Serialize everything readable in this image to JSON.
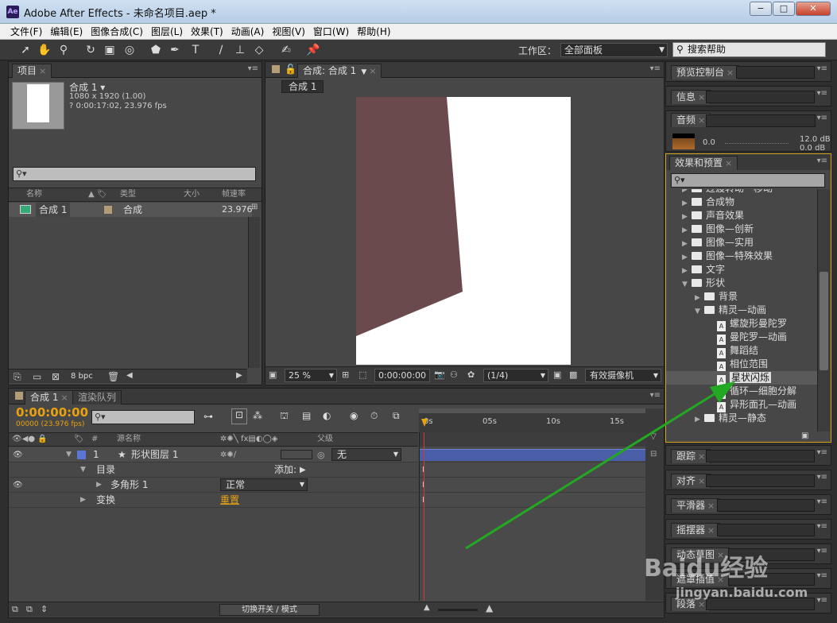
{
  "window": {
    "title": "Adobe After Effects - 未命名项目.aep *",
    "logo": "Ae",
    "minimize": "−",
    "maximize": "□",
    "close": "✕"
  },
  "menu": [
    "文件(F)",
    "编辑(E)",
    "图像合成(C)",
    "图层(L)",
    "效果(T)",
    "动画(A)",
    "视图(V)",
    "窗口(W)",
    "帮助(H)"
  ],
  "toolbar": {
    "workspace_label": "工作区：",
    "workspace_value": "全部面板",
    "search_help": "搜索帮助"
  },
  "project": {
    "tab": "项目",
    "comp_name": "合成 1 ▾",
    "comp_res": "1080 x 1920 (1.00)",
    "comp_dur": "? 0:00:17:02, 23.976 fps",
    "columns": [
      "名称",
      "类型",
      "大小",
      "帧速率"
    ],
    "item": {
      "name": "合成 1",
      "type": "合成",
      "fps": "23.976"
    },
    "bpc": "8 bpc"
  },
  "comp": {
    "tab": "合成: 合成 1",
    "subtab": "合成 1",
    "zoom": "25 %",
    "timecode": "0:00:00:00",
    "resolution": "(1/4)",
    "camera": "有效摄像机"
  },
  "right": {
    "preview": "预览控制台",
    "info": "信息",
    "audio": "音频",
    "audio_level": "0.0",
    "audio_db1": "12.0 dB",
    "audio_db2": "0.0 dB",
    "effects_tab": "效果和预置",
    "tracker": "跟踪",
    "align": "对齐",
    "smoother": "平滑器",
    "wiggler": "摇摆器",
    "motion_sketch": "动态草图",
    "mask_interp": "遮罩插值",
    "paragraph": "段落"
  },
  "effects": [
    {
      "depth": 1,
      "kind": "folder",
      "label": "过渡转动—移动",
      "open": false
    },
    {
      "depth": 1,
      "kind": "folder",
      "label": "合成物",
      "open": false
    },
    {
      "depth": 1,
      "kind": "folder",
      "label": "声音效果",
      "open": false
    },
    {
      "depth": 1,
      "kind": "folder",
      "label": "图像—创新",
      "open": false
    },
    {
      "depth": 1,
      "kind": "folder",
      "label": "图像—实用",
      "open": false
    },
    {
      "depth": 1,
      "kind": "folder",
      "label": "图像—特殊效果",
      "open": false
    },
    {
      "depth": 1,
      "kind": "folder",
      "label": "文字",
      "open": false
    },
    {
      "depth": 1,
      "kind": "folder",
      "label": "形状",
      "open": true
    },
    {
      "depth": 2,
      "kind": "folder",
      "label": "背景",
      "open": false
    },
    {
      "depth": 2,
      "kind": "folder",
      "label": "精灵—动画",
      "open": true
    },
    {
      "depth": 3,
      "kind": "preset",
      "label": "螺旋形曼陀罗"
    },
    {
      "depth": 3,
      "kind": "preset",
      "label": "曼陀罗—动画"
    },
    {
      "depth": 3,
      "kind": "preset",
      "label": "舞蹈结"
    },
    {
      "depth": 3,
      "kind": "preset",
      "label": "相位范围"
    },
    {
      "depth": 3,
      "kind": "preset",
      "label": "星状闪烁",
      "selected": true
    },
    {
      "depth": 3,
      "kind": "preset",
      "label": "循环—细胞分解"
    },
    {
      "depth": 3,
      "kind": "preset",
      "label": "异形面孔—动画"
    },
    {
      "depth": 2,
      "kind": "folder",
      "label": "精灵—静态",
      "open": false
    }
  ],
  "timeline": {
    "tab": "合成 1",
    "tab2": "渲染队列",
    "timecode": "0:00:00:00",
    "fps_info": "00000 (23.976 fps)",
    "col_source": "源名称",
    "col_parent": "父级",
    "num": "#",
    "ruler": [
      "0s",
      "05s",
      "10s",
      "15s"
    ],
    "layer": {
      "index": "1",
      "name": "形状图层 1",
      "parent": "无"
    },
    "content": "目录",
    "add": "添加:",
    "polygon": "多角形 1",
    "mode": "正常",
    "transform": "变换",
    "reset": "重置",
    "toggle": "切换开关 / 模式"
  },
  "watermark": {
    "brand": "Baidu经验",
    "url": "jingyan.baidu.com"
  },
  "colors": {
    "shape": "#6b4a4e",
    "arrow": "#22a822",
    "layer_bar": "#4a5ea8",
    "accent": "#e8a10f"
  }
}
